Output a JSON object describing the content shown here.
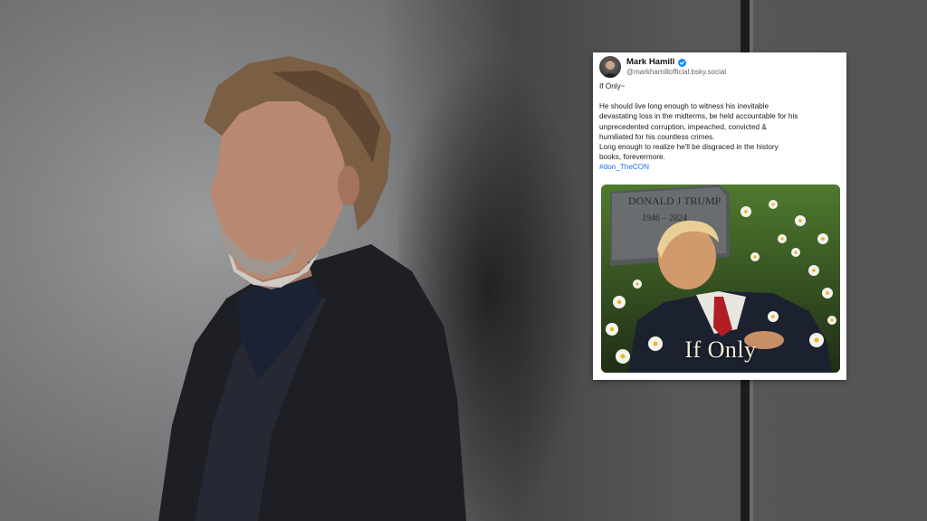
{
  "post": {
    "author_name": "Mark Hamill",
    "author_handle": "@markhamillofficial.bsky.social",
    "lines": [
      "If Only~",
      "",
      "He should live long enough to witness his inevitable",
      "devastating loss in the midterms, be held accountable for his",
      "unprecedented corruption, impeached, convicted &",
      "humiliated for his countless crimes.",
      "Long enough to realize he'll be disgraced in the history",
      "books, forevermore."
    ],
    "hashtag": "#don_TheCON",
    "image": {
      "caption": "If Only",
      "headstone_name": "DONALD J TRUMP",
      "headstone_dates": "1946 – 2024"
    }
  },
  "colors": {
    "link": "#1a73e8",
    "verified": "#1a8cff"
  },
  "icons": {
    "verified": "verified-badge-icon"
  }
}
